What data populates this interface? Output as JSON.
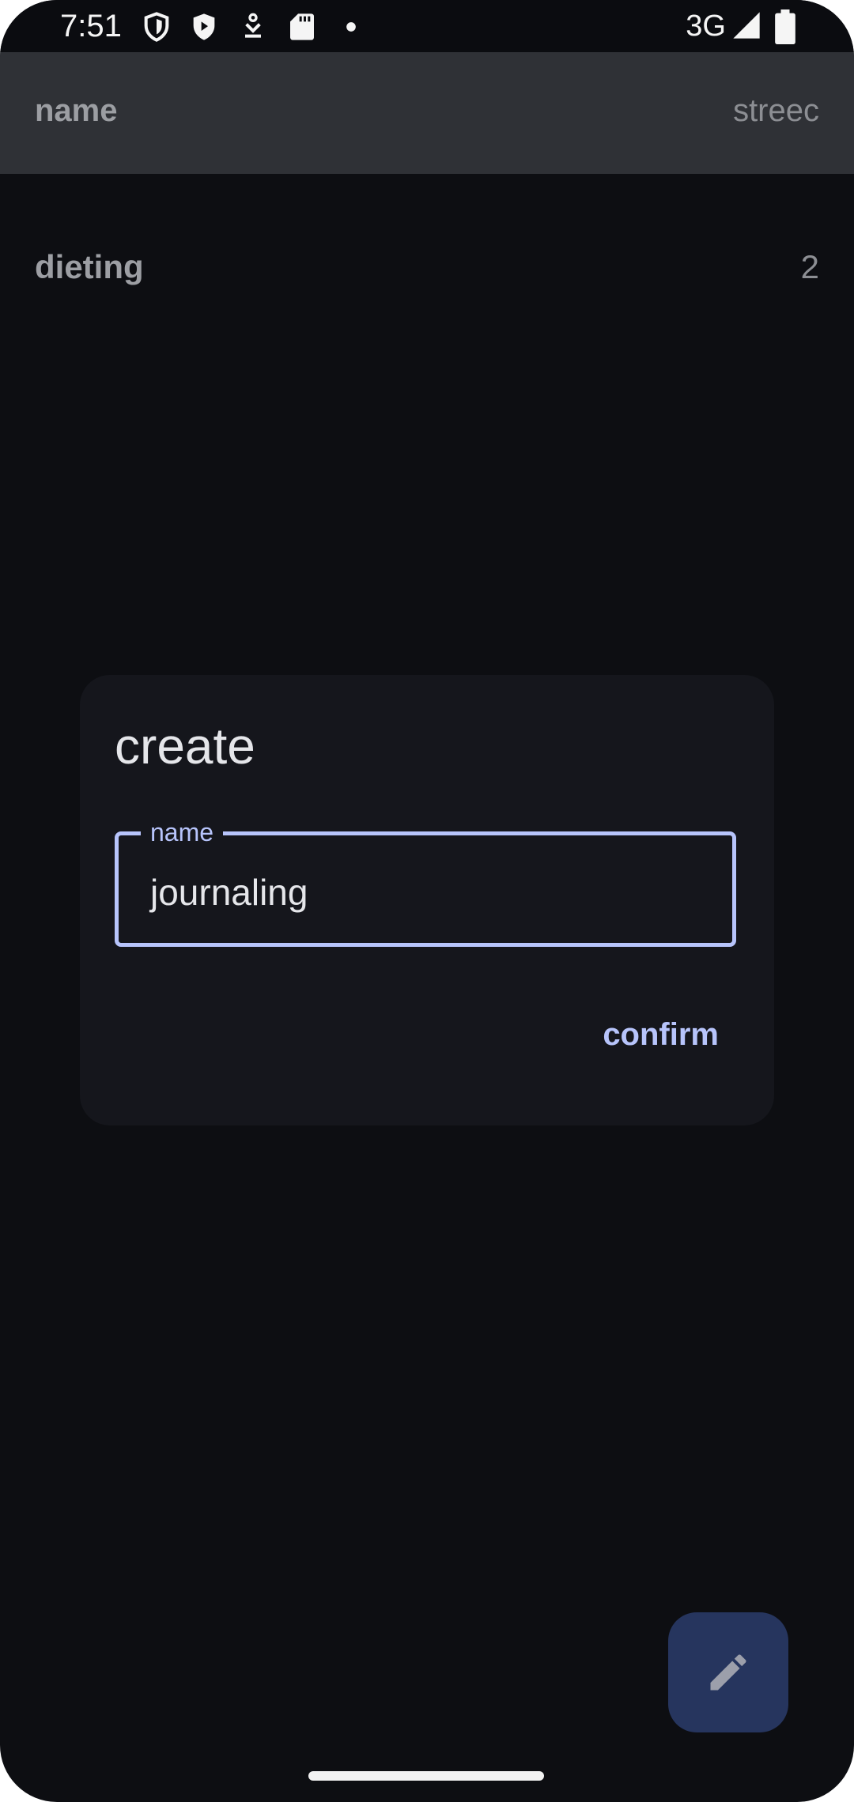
{
  "status_bar": {
    "time": "7:51",
    "network": "3G",
    "icons": [
      "shield-icon",
      "play-shield-icon",
      "download-icon",
      "sd-card-icon",
      "notification-dot-icon",
      "signal-icon",
      "battery-icon"
    ]
  },
  "header": {
    "name_label": "name",
    "streak_label": "streec"
  },
  "list": {
    "items": [
      {
        "name": "dieting",
        "count": "2"
      }
    ]
  },
  "dialog": {
    "title": "create",
    "field_label": "name",
    "field_value": "journaling",
    "confirm_label": "confirm"
  },
  "fab": {
    "icon": "pencil-icon"
  },
  "colors": {
    "background": "#0d0e12",
    "header": "#2f3136",
    "dialog": "#15161c",
    "accent": "#b7c4fb",
    "fab": "#26355e"
  }
}
